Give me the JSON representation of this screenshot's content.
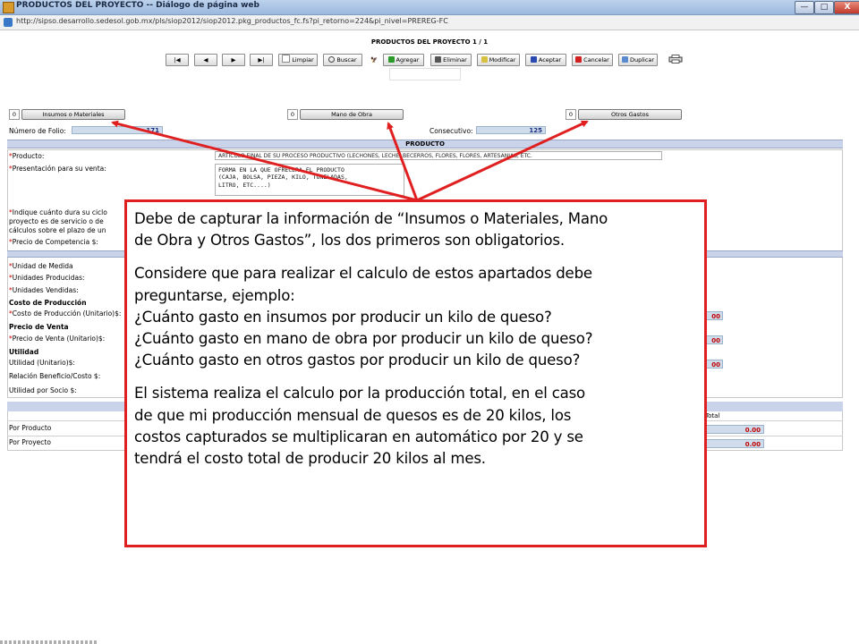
{
  "window": {
    "title": "PRODUCTOS DEL PROYECTO -- Diálogo de página web",
    "minimize_label": "—",
    "maximize_label": "□",
    "close_label": "X",
    "url": "http://sipso.desarrollo.sedesol.gob.mx/pls/siop2012/siop2012.pkg_productos_fc.fs?pi_retorno=224&pi_nivel=PREREG-FC"
  },
  "page": {
    "title": "PRODUCTOS DEL PROYECTO 1 / 1"
  },
  "toolbar": {
    "first": "|◀",
    "prev": "◀",
    "next": "▶",
    "last": "▶|",
    "limpiar": "Limpiar",
    "buscar": "Buscar",
    "agregar": "Agregar",
    "eliminar": "Eliminar",
    "modificar": "Modificar",
    "aceptar": "Aceptar",
    "cancelar": "Cancelar",
    "duplicar": "Duplicar"
  },
  "tabs": [
    {
      "count": "0",
      "label": "Insumos o Materiales"
    },
    {
      "count": "0",
      "label": "Mano de Obra"
    },
    {
      "count": "0",
      "label": "Otros Gastos"
    }
  ],
  "form": {
    "folio_label": "Número de Folio:",
    "folio_value": "171",
    "consecutivo_label": "Consecutivo:",
    "consecutivo_value": "125",
    "section_producto": "PRODUCTO",
    "producto_label": "Producto:",
    "producto_value": "ARTICULO FINAL DE SU PROCESO PRODUCTIVO (LECHONES, LECHE, BECERROS, FLORES, FLORES, ARTESANIAS, ETC.",
    "presentacion_label": "Presentación para su venta:",
    "presentacion_value": "FORMA EN LA QUE OFRECERA EL PRODUCTO\n(CAJA, BOLSA, PIEZA, KILO, TONELADAS,\nLITRO, ETC....)",
    "indique_line1": "Indique cuánto dura su ciclo",
    "indique_line2": "proyecto es de servicio o de",
    "indique_line3": "cálculos sobre el plazo de un",
    "precio_competencia_label": "Precio de Competencia $:",
    "unidad_medida_label": "Unidad de Medida",
    "unidades_producidas_label": "Unidades Producidas:",
    "unidades_vendidas_label": "Unidades Vendidas:",
    "costo_produccion_title": "Costo de Producción",
    "costo_produccion_label": "Costo de Producción (Unitario)$:",
    "precio_venta_title": "Precio de Venta",
    "precio_venta_label": "Precio de Venta (Unitario)$:",
    "utilidad_title": "Utilidad",
    "utilidad_label": "Utilidad (Unitario)$:",
    "relacion_label": "Relación Beneficio/Costo $:",
    "utilidad_socio_label": "Utilidad por Socio $:",
    "right_value_1": "00",
    "right_value_2": "00",
    "right_value_3": "00"
  },
  "totals": {
    "header_total": "Total",
    "por_producto_label": "Por Producto",
    "por_producto_value": "0.00",
    "por_proyecto_label": "Por Proyecto",
    "por_proyecto_value": "0.00"
  },
  "callout": {
    "p1_line1": "Debe de capturar la información de “Insumos o Materiales, Mano",
    "p1_line2": "de Obra y Otros Gastos”,  los dos primeros son obligatorios.",
    "p2_line1": "Considere que para realizar el calculo de estos apartados debe",
    "p2_line2": "preguntarse, ejemplo:",
    "p2_line3": "¿Cuánto gasto en insumos por producir un kilo de queso?",
    "p2_line4": "¿Cuánto gasto en mano de obra por producir un kilo de queso?",
    "p2_line5": "¿Cuánto gasto en otros gastos por producir un kilo de queso?",
    "p3_line1": "El sistema realiza el calculo por la producción total,  en el caso",
    "p3_line2": "de que mi producción mensual de quesos es de 20 kilos, los",
    "p3_line3": "costos capturados se multiplicaran en automático por 20 y se",
    "p3_line4": "tendrá el costo total de producir 20 kilos al mes."
  },
  "colors": {
    "annotation_red": "#e02020",
    "field_blue": "#cfdcec",
    "section_header": "#c9d3ea",
    "required_asterisk": "#d40000"
  }
}
